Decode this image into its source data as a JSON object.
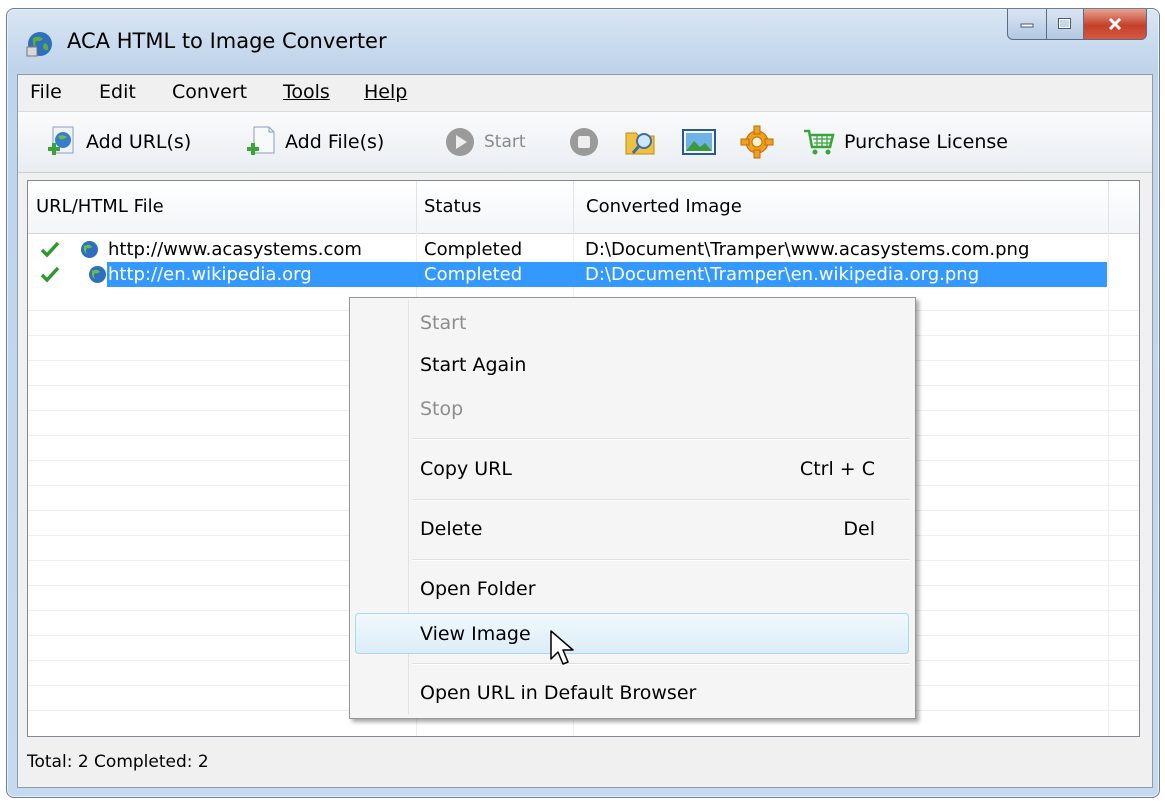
{
  "window": {
    "title": "ACA HTML to Image Converter"
  },
  "menubar": {
    "items": [
      "File",
      "Edit",
      "Convert",
      "Tools",
      "Help"
    ]
  },
  "toolbar": {
    "add_urls": "Add URL(s)",
    "add_files": "Add File(s)",
    "start": "Start",
    "purchase": "Purchase License"
  },
  "list": {
    "columns": [
      "URL/HTML File",
      "Status",
      "Converted Image"
    ],
    "rows": [
      {
        "url": "http://www.acasystems.com",
        "status": "Completed",
        "image": "D:\\Document\\Tramper\\www.acasystems.com.png"
      },
      {
        "url": "http://en.wikipedia.org",
        "status": "Completed",
        "image": "D:\\Document\\Tramper\\en.wikipedia.org.png"
      }
    ]
  },
  "context_menu": {
    "start": "Start",
    "start_again": "Start Again",
    "stop": "Stop",
    "copy_url": "Copy URL",
    "copy_url_shortcut": "Ctrl + C",
    "delete": "Delete",
    "delete_shortcut": "Del",
    "open_folder": "Open Folder",
    "view_image": "View Image",
    "open_in_browser": "Open URL in Default Browser"
  },
  "statusbar": {
    "text": "Total: 2  Completed: 2"
  },
  "colors": {
    "selection": "#3399ff",
    "check": "#2e9a2e",
    "accent": "#3a7cc9"
  }
}
